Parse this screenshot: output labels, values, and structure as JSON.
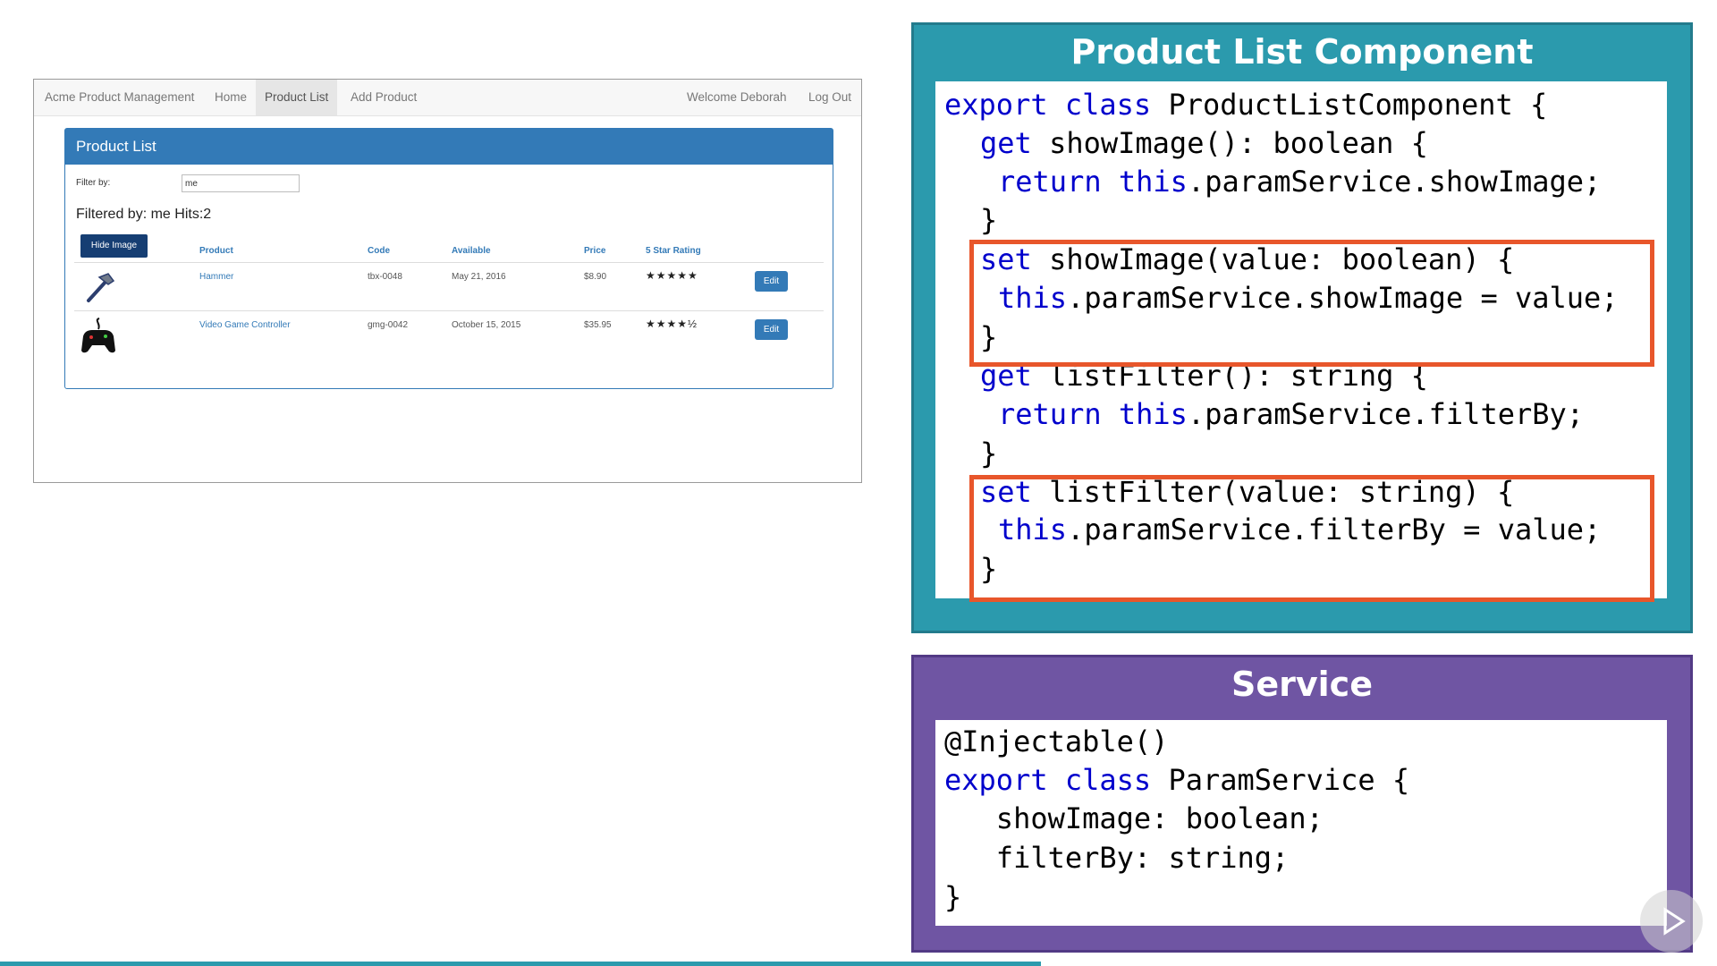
{
  "app": {
    "navbar": {
      "brand": "Acme Product Management",
      "items": [
        "Home",
        "Product List",
        "Add Product"
      ],
      "active": "Product List",
      "welcome": "Welcome Deborah",
      "logout": "Log Out"
    },
    "panel": {
      "title": "Product List",
      "filter_label": "Filter by:",
      "filter_value": "me",
      "filtered_text": "Filtered by: me Hits:2",
      "hide_image_label": "Hide Image",
      "columns": [
        "Product",
        "Code",
        "Available",
        "Price",
        "5 Star Rating"
      ],
      "rows": [
        {
          "product": "Hammer",
          "code": "tbx-0048",
          "available": "May 21, 2016",
          "price": "$8.90",
          "stars": "★★★★★",
          "edit": "Edit",
          "image_icon": "hammer-icon"
        },
        {
          "product": "Video Game Controller",
          "code": "gmg-0042",
          "available": "October 15, 2015",
          "price": "$35.95",
          "stars": "★★★★½",
          "edit": "Edit",
          "image_icon": "game-controller-icon"
        }
      ]
    }
  },
  "component_box": {
    "title": "Product List Component",
    "color": "#2b9aad",
    "highlight_color": "#e8562b",
    "lines": [
      {
        "kw": "export class",
        "rest": " ProductListComponent {"
      },
      {
        "kw": "get",
        "rest": " showImage(): boolean {"
      },
      {
        "kw": "return this",
        "rest": ".paramService.showImage;"
      },
      {
        "kw": "",
        "rest": "}"
      },
      {
        "kw": "set",
        "rest": " showImage(value: boolean) {"
      },
      {
        "kw": "this",
        "rest": ".paramService.showImage = value;"
      },
      {
        "kw": "",
        "rest": "}"
      },
      {
        "kw": "get",
        "rest": " listFilter(): string {"
      },
      {
        "kw": "return this",
        "rest": ".paramService.filterBy;"
      },
      {
        "kw": "",
        "rest": "}"
      },
      {
        "kw": "set",
        "rest": " listFilter(value: string) {"
      },
      {
        "kw": "this",
        "rest": ".paramService.filterBy = value;"
      },
      {
        "kw": "",
        "rest": "}"
      }
    ]
  },
  "service_box": {
    "title": "Service",
    "color": "#6f55a3",
    "lines": [
      {
        "kw": "",
        "rest": "@Injectable()"
      },
      {
        "kw": "export class",
        "rest": " ParamService {"
      },
      {
        "kw": "",
        "rest": "   showImage: boolean;"
      },
      {
        "kw": "",
        "rest": "   filterBy: string;"
      },
      {
        "kw": "",
        "rest": "}"
      }
    ]
  }
}
